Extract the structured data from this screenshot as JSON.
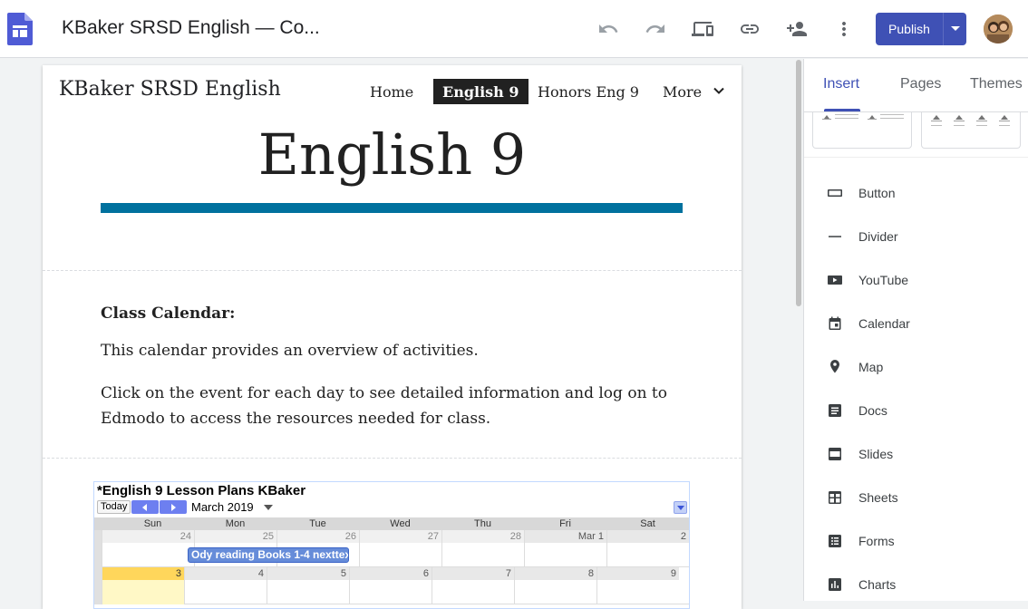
{
  "app": {
    "doc_title": "KBaker SRSD English — Co...",
    "publish_label": "Publish"
  },
  "site": {
    "title": "KBaker SRSD English",
    "nav": [
      {
        "label": "Home",
        "active": false
      },
      {
        "label": "English 9",
        "active": true
      },
      {
        "label": "Honors Eng 9",
        "active": false
      },
      {
        "label": "More",
        "active": false
      }
    ],
    "heading": "English 9",
    "heading_bar_color": "#00719e",
    "text_heading": "Class Calendar:",
    "text_p1": "This calendar provides an overview of activities.",
    "text_p2": "Click on the event for each day to see detailed information and log on to Edmodo to access the resources needed for class."
  },
  "calendar": {
    "title": "*English 9 Lesson Plans KBaker",
    "today_label": "Today",
    "month_label": "March 2019",
    "weekdays": [
      "Sun",
      "Mon",
      "Tue",
      "Wed",
      "Thu",
      "Fri",
      "Sat"
    ],
    "week1": [
      "24",
      "25",
      "26",
      "27",
      "28",
      "Mar 1",
      "2"
    ],
    "week2": [
      "3",
      "4",
      "5",
      "6",
      "7",
      "8",
      "9"
    ],
    "event": "Ody reading Books 1-4 nexttext",
    "today_color": "#ffd65b",
    "event_color": "#668cd9"
  },
  "panel": {
    "tabs": [
      "Insert",
      "Pages",
      "Themes"
    ],
    "active_tab": "Insert",
    "items": [
      {
        "label": "Button",
        "icon": "button-icon"
      },
      {
        "label": "Divider",
        "icon": "divider-icon"
      },
      {
        "label": "YouTube",
        "icon": "youtube-icon"
      },
      {
        "label": "Calendar",
        "icon": "calendar-icon"
      },
      {
        "label": "Map",
        "icon": "map-pin-icon"
      },
      {
        "label": "Docs",
        "icon": "docs-icon"
      },
      {
        "label": "Slides",
        "icon": "slides-icon"
      },
      {
        "label": "Sheets",
        "icon": "sheets-icon"
      },
      {
        "label": "Forms",
        "icon": "forms-icon"
      },
      {
        "label": "Charts",
        "icon": "charts-icon"
      }
    ]
  },
  "colors": {
    "accent": "#3f51b5"
  }
}
